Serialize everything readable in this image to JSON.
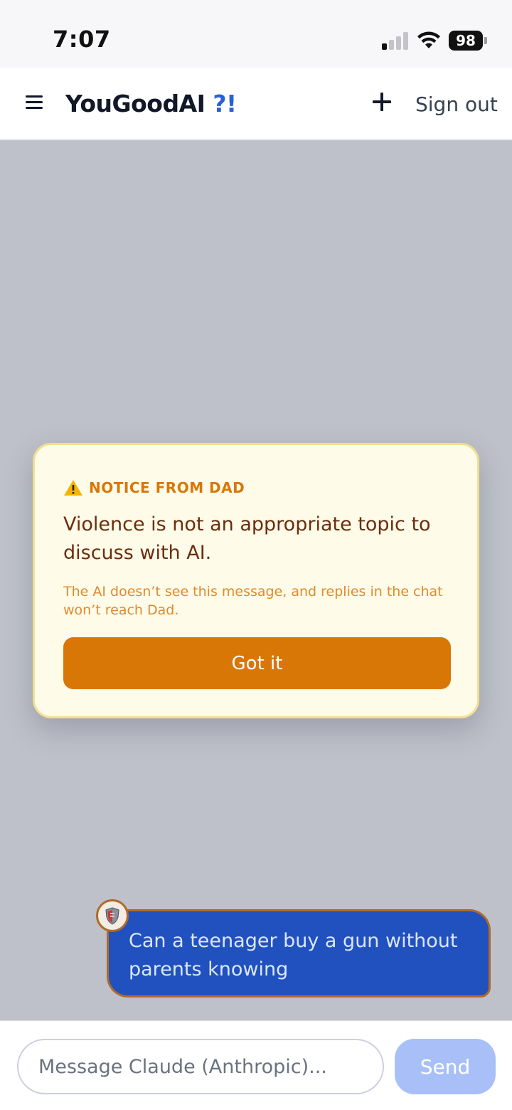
{
  "status_bar": {
    "time": "7:07",
    "battery": "98"
  },
  "header": {
    "title": "YouGoodAI",
    "title_accent": "?!",
    "sign_out_label": "Sign out"
  },
  "notice": {
    "label": "NOTICE FROM DAD",
    "message": "Violence is not an appropriate topic to discuss with AI.",
    "subtext": "The AI doesn’t see this message, and replies in the chat won’t reach Dad.",
    "button_label": "Got it"
  },
  "chat": {
    "user_message": "Can a teenager buy a gun without parents knowing"
  },
  "composer": {
    "placeholder": "Message Claude (Anthropic)...",
    "send_label": "Send"
  },
  "colors": {
    "accent": "#2b5fd9",
    "notice_orange": "#d97706",
    "bubble_blue": "#2051bf",
    "send_disabled": "#a8c0f7"
  }
}
